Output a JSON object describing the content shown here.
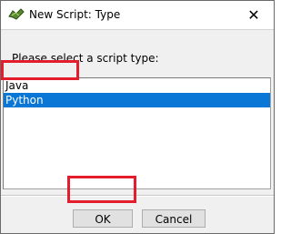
{
  "window": {
    "title": "New Script: Type",
    "icon": "script-icon",
    "close_label": "✕"
  },
  "dialog": {
    "prompt": "Please select a script type:",
    "script_types": [
      {
        "label": "Java",
        "selected": false
      },
      {
        "label": "Python",
        "selected": true
      }
    ]
  },
  "buttons": {
    "ok_label": "OK",
    "cancel_label": "Cancel"
  },
  "colors": {
    "selection": "#0a76d6",
    "annotation_highlight": "#e31d2b"
  }
}
